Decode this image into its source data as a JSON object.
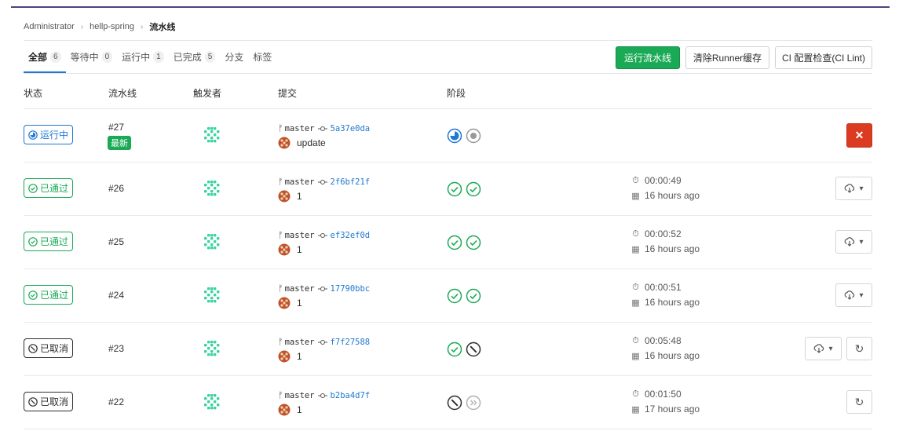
{
  "breadcrumb": {
    "items": [
      "Administrator",
      "hellp-spring"
    ],
    "current": "流水线"
  },
  "tabs": [
    {
      "label": "全部",
      "count": "6"
    },
    {
      "label": "等待中",
      "count": "0"
    },
    {
      "label": "运行中",
      "count": "1"
    },
    {
      "label": "已完成",
      "count": "5"
    },
    {
      "label": "分支",
      "count": ""
    },
    {
      "label": "标签",
      "count": ""
    }
  ],
  "buttons": {
    "run": "运行流水线",
    "clear": "清除Runner缓存",
    "lint": "CI 配置检查(CI Lint)"
  },
  "columns": [
    "状态",
    "流水线",
    "触发者",
    "提交",
    "阶段"
  ],
  "colors": {
    "running": "#1f78d1",
    "passed": "#1aaa55",
    "canceled": "#2e2e2e",
    "cancel_button": "#db3b21"
  },
  "pipelines": [
    {
      "status": "running",
      "status_label": "运行中",
      "id": "#27",
      "tag": "最新",
      "branch": "master",
      "sha": "5a37e0da",
      "message": "update",
      "stages": [
        "running",
        "created"
      ],
      "duration": "",
      "finished": "",
      "actions": [
        "cancel"
      ]
    },
    {
      "status": "passed",
      "status_label": "已通过",
      "id": "#26",
      "tag": "",
      "branch": "master",
      "sha": "2f6bf21f",
      "message": "1",
      "stages": [
        "success",
        "success"
      ],
      "duration": "00:00:49",
      "finished": "16 hours ago",
      "actions": [
        "download"
      ]
    },
    {
      "status": "passed",
      "status_label": "已通过",
      "id": "#25",
      "tag": "",
      "branch": "master",
      "sha": "ef32ef0d",
      "message": "1",
      "stages": [
        "success",
        "success"
      ],
      "duration": "00:00:52",
      "finished": "16 hours ago",
      "actions": [
        "download"
      ]
    },
    {
      "status": "passed",
      "status_label": "已通过",
      "id": "#24",
      "tag": "",
      "branch": "master",
      "sha": "17790bbc",
      "message": "1",
      "stages": [
        "success",
        "success"
      ],
      "duration": "00:00:51",
      "finished": "16 hours ago",
      "actions": [
        "download"
      ]
    },
    {
      "status": "canceled",
      "status_label": "已取消",
      "id": "#23",
      "tag": "",
      "branch": "master",
      "sha": "f7f27588",
      "message": "1",
      "stages": [
        "success",
        "canceled"
      ],
      "duration": "00:05:48",
      "finished": "16 hours ago",
      "actions": [
        "download",
        "retry"
      ]
    },
    {
      "status": "canceled",
      "status_label": "已取消",
      "id": "#22",
      "tag": "",
      "branch": "master",
      "sha": "b2ba4d7f",
      "message": "1",
      "stages": [
        "canceled",
        "skipped"
      ],
      "duration": "00:01:50",
      "finished": "17 hours ago",
      "actions": [
        "retry"
      ]
    }
  ]
}
